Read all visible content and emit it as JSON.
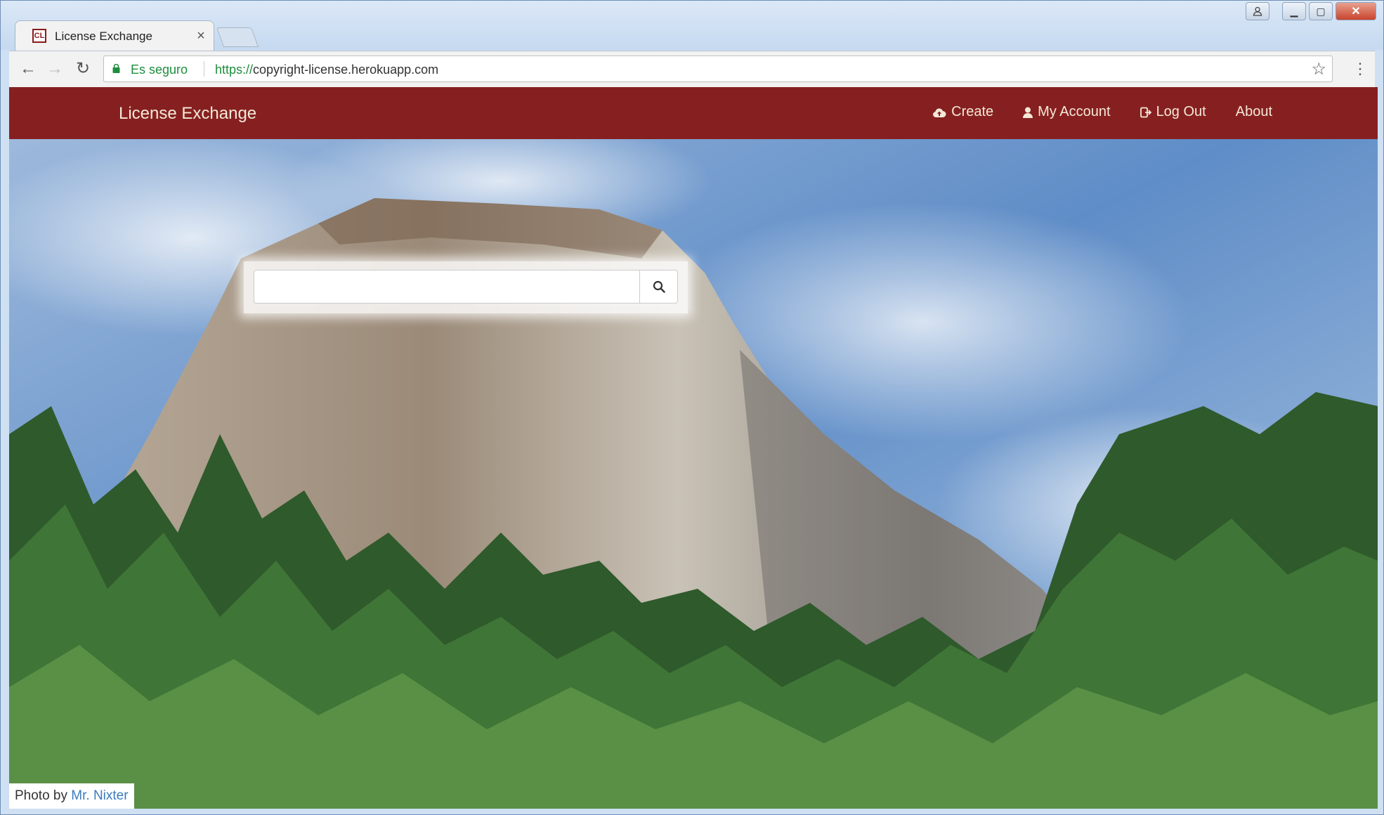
{
  "browser": {
    "tab": {
      "favicon_text": "CL",
      "title": "License Exchange",
      "close_glyph": "×"
    },
    "toolbar": {
      "back_glyph": "←",
      "forward_glyph": "→",
      "reload_glyph": "↻",
      "security_label": "Es seguro",
      "url_scheme": "https://",
      "url_rest": "copyright-license.herokuapp.com",
      "bookmark_glyph": "☆",
      "menu_glyph": "⋮"
    },
    "window_controls": {
      "user_glyph": "👤",
      "minimize_glyph": "▁",
      "maximize_glyph": "▢",
      "close_glyph": "✕"
    }
  },
  "navbar": {
    "brand": "License Exchange",
    "links": [
      {
        "label": "Create",
        "icon": "cloud-upload-icon"
      },
      {
        "label": "My Account",
        "icon": "user-icon"
      },
      {
        "label": "Log Out",
        "icon": "log-out-icon"
      },
      {
        "label": "About",
        "icon": ""
      }
    ]
  },
  "search": {
    "value": "",
    "placeholder": "",
    "icon": "search-icon"
  },
  "credit": {
    "prefix": "Photo by",
    "author": "Mr. Nixter"
  },
  "colors": {
    "navbar": "#862020",
    "nav_text": "#f4e8d8",
    "secure_green": "#1e8e3e",
    "link_blue": "#3a7bbf"
  }
}
